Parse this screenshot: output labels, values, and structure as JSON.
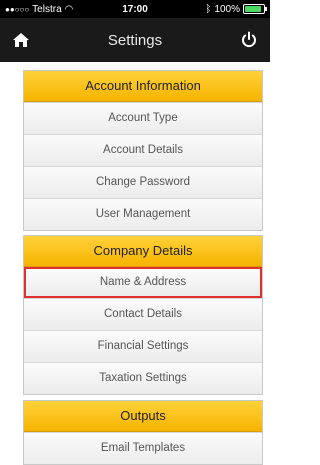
{
  "status_bar": {
    "carrier": "Telstra",
    "time": "17:00",
    "battery": "100%"
  },
  "nav": {
    "title": "Settings",
    "home_icon": "home-icon",
    "power_icon": "power-icon"
  },
  "sections": [
    {
      "title": "Account Information",
      "items": [
        "Account Type",
        "Account Details",
        "Change Password",
        "User Management"
      ]
    },
    {
      "title": "Company Details",
      "items": [
        "Name & Address",
        "Contact Details",
        "Financial Settings",
        "Taxation Settings"
      ]
    },
    {
      "title": "Outputs",
      "items": [
        "Email Templates"
      ]
    }
  ],
  "colors": {
    "header_yellow": "#f6b400",
    "highlight_red": "#e03030",
    "nav_bg": "#1a1a1a"
  }
}
